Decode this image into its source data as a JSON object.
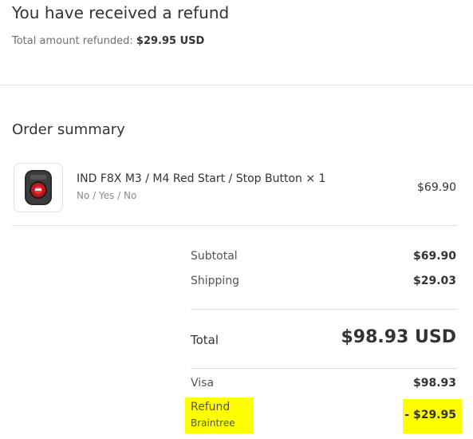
{
  "header": {
    "title": "You have received a refund",
    "total_refunded_label": "Total amount refunded:",
    "total_refunded_value": "$29.95 USD"
  },
  "order_summary": {
    "title": "Order summary",
    "item": {
      "name": "IND F8X M3 / M4 Red Start / Stop Button × 1",
      "variant": "No / Yes / No",
      "price": "$69.90",
      "image_icon": "red-start-stop-button-icon"
    },
    "subtotal": {
      "label": "Subtotal",
      "value": "$69.90"
    },
    "shipping": {
      "label": "Shipping",
      "value": "$29.03"
    },
    "total": {
      "label": "Total",
      "value": "$98.93 USD"
    },
    "payment": {
      "label": "Visa",
      "value": "$98.93"
    },
    "refund": {
      "label": "Refund",
      "gateway": "Braintree",
      "value": "- $29.95"
    }
  },
  "colors": {
    "highlight": "#ffff00",
    "text": "#333333",
    "muted": "#707070"
  }
}
